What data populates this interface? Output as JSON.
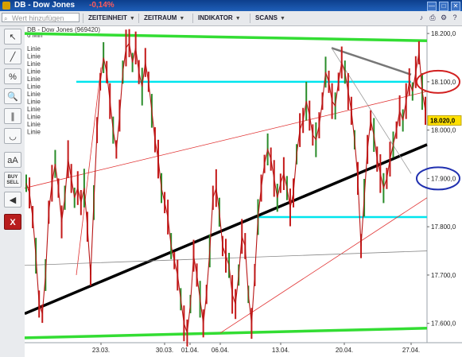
{
  "window": {
    "title": "DB - Dow Jones",
    "change": "-0,14%",
    "buttons": [
      "—",
      "□",
      "✕"
    ]
  },
  "menubar": {
    "search_placeholder": "Wert hinzufügen",
    "items": [
      "ZEITEINHEIT",
      "ZEITRAUM",
      "INDIKATOR",
      "SCANS"
    ]
  },
  "tools": [
    {
      "icon": "cursor-icon",
      "glyph": "↖"
    },
    {
      "icon": "line-icon",
      "glyph": "╱"
    },
    {
      "icon": "percent-icon",
      "glyph": "%"
    },
    {
      "icon": "zoom-icon",
      "glyph": "🔍"
    },
    {
      "icon": "parallel-lines-icon",
      "glyph": "∥"
    },
    {
      "icon": "arc-icon",
      "glyph": "◡"
    },
    {
      "icon": "text-icon",
      "glyph": "aA"
    },
    {
      "icon": "buy-sell-icon",
      "glyph": "BUY SELL"
    },
    {
      "icon": "speaker-icon",
      "glyph": "◀"
    },
    {
      "icon": "close-icon",
      "glyph": "X"
    }
  ],
  "chart_data": {
    "type": "line",
    "instrument": "DB - Dow Jones (969420)",
    "timeframe": "6 Min",
    "x_ticks": [
      "23.03.",
      "30.03.",
      "01.04.",
      "06.04.",
      "13.04.",
      "20.04.",
      "27.04."
    ],
    "y_ticks": [
      "18.200,0",
      "18.100,0",
      "18.000,0",
      "17.900,0",
      "17.800,0",
      "17.700,0",
      "17.600,0"
    ],
    "ylim": [
      17560,
      18215
    ],
    "last_price": "18.020,0",
    "legend": [
      "Linie",
      "Linie",
      "Linie",
      "Linie",
      "Linie",
      "Linie",
      "Linie",
      "Linie",
      "Linie",
      "Linie",
      "Linie",
      "Linie"
    ],
    "series": [
      {
        "values": [
          17890,
          17870,
          17820,
          17740,
          17640,
          17620,
          17700,
          17830,
          17890,
          17930,
          17880,
          17810,
          17860,
          17940,
          17900,
          17860,
          17880,
          17850,
          17880,
          17800,
          17700,
          17850,
          18000,
          18100,
          18150,
          18120,
          18060,
          18000,
          17960,
          18030,
          18120,
          18170,
          18180,
          18140,
          18170,
          18120,
          18090,
          18140,
          18100,
          18040,
          17980,
          17940,
          17880,
          17850,
          17820,
          17760,
          17730,
          17700,
          17650,
          17600,
          17580,
          17640,
          17740,
          17700,
          17650,
          17600,
          17660,
          17750,
          17860,
          17880,
          17830,
          17760,
          17740,
          17720,
          17660,
          17640,
          17700,
          17780,
          17760,
          17660,
          17600,
          17700,
          17820,
          17880,
          17930,
          17960,
          17940,
          17900,
          17860,
          17890,
          17910,
          17880,
          17840,
          17870,
          17950,
          18000,
          18020,
          18060,
          18030,
          17990,
          17980,
          18010,
          18060,
          18120,
          18100,
          18060,
          18050,
          18100,
          18140,
          18120,
          18080,
          18040,
          17980,
          17900,
          17760,
          17860,
          17960,
          18020,
          17990,
          17940,
          17910,
          17880,
          17900,
          17940,
          17970,
          18000,
          18040,
          18020,
          18060,
          18100,
          18080,
          18120,
          18160,
          18080,
          18040
        ]
      }
    ],
    "trendlines": [
      {
        "color": "#33dd33",
        "width": "thick",
        "points": [
          [
            "start",
            18200
          ],
          [
            "end",
            18185
          ]
        ]
      },
      {
        "color": "#33dd33",
        "width": "thick",
        "points": [
          [
            "start",
            17570
          ],
          [
            "end",
            17590
          ]
        ]
      },
      {
        "color": "#00e5ee",
        "width": "medium",
        "points": [
          [
            "20.03.",
            18100
          ],
          [
            "27.04.",
            18100
          ]
        ]
      },
      {
        "color": "#00e5ee",
        "width": "medium",
        "points": [
          [
            "08.04.",
            17820
          ],
          [
            "end",
            17820
          ]
        ]
      },
      {
        "color": "#000000",
        "width": "thick",
        "points": [
          [
            "start",
            17620
          ],
          [
            "end",
            17970
          ]
        ]
      },
      {
        "color": "#e03030",
        "width": "thin",
        "points": [
          [
            "start",
            17880
          ],
          [
            "end",
            18080
          ]
        ]
      },
      {
        "color": "#e03030",
        "width": "thin",
        "points": [
          [
            "06.04.",
            17580
          ],
          [
            "end",
            17860
          ]
        ]
      },
      {
        "color": "#e03030",
        "width": "thin",
        "points": [
          [
            "20.03.",
            17700
          ],
          [
            "23.03.",
            18130
          ]
        ]
      },
      {
        "color": "#888888",
        "width": "thin",
        "points": [
          [
            "start",
            17720
          ],
          [
            "end",
            17750
          ]
        ]
      },
      {
        "color": "#777777",
        "width": "medium",
        "points": [
          [
            "17.04.",
            18170
          ],
          [
            "27.04.",
            18115
          ]
        ]
      },
      {
        "color": "#999999",
        "width": "thin",
        "points": [
          [
            "17.04.",
            18170
          ],
          [
            "27.04.",
            17910
          ]
        ]
      }
    ],
    "annotations": [
      {
        "shape": "ellipse",
        "color": "#d22020",
        "at": "18.100,0"
      },
      {
        "shape": "ellipse",
        "color": "#2030b0",
        "at": "17.900,0"
      }
    ],
    "grid": false,
    "legend_position": "top-left"
  }
}
